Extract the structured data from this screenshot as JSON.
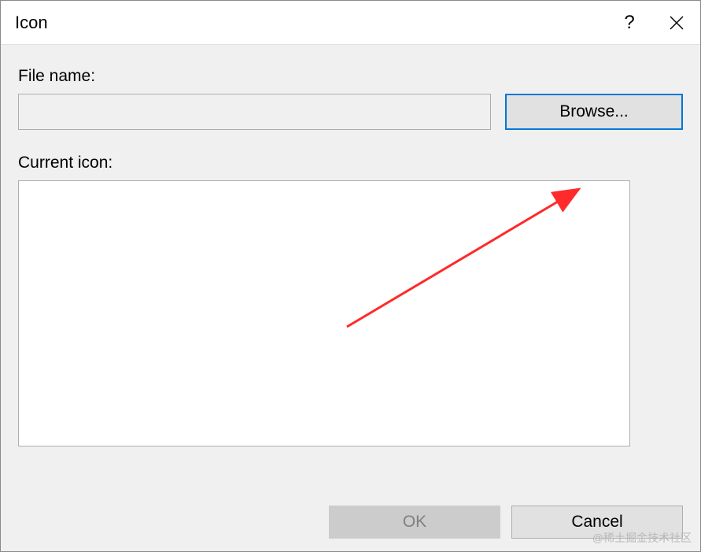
{
  "titlebar": {
    "title": "Icon",
    "help_symbol": "?",
    "close_symbol": "✕"
  },
  "content": {
    "file_name_label": "File name:",
    "file_name_value": "",
    "browse_label": "Browse...",
    "current_icon_label": "Current icon:"
  },
  "buttons": {
    "ok_label": "OK",
    "cancel_label": "Cancel"
  },
  "watermark": "@稀土掘金技术社区"
}
